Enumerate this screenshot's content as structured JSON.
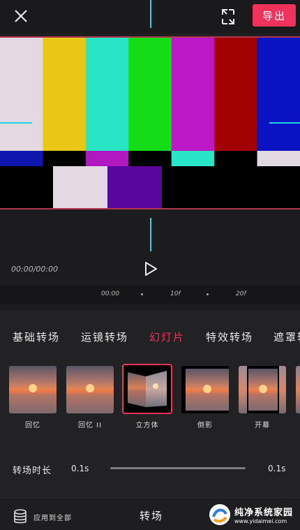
{
  "topbar": {
    "export_label": "导出"
  },
  "preview": {
    "bars_top": [
      "#e2d9e2",
      "#e9c714",
      "#28e5c6",
      "#14dc16",
      "#bd18c6",
      "#a20102",
      "#0a13c4"
    ],
    "bars_mid": [
      "#0f16b0",
      "#000000",
      "#b218c0",
      "#000000",
      "#28e5c6",
      "#000000",
      "#e2d9e2"
    ],
    "bars_bottom": [
      "#000000",
      "#e2d9e2",
      "#58069c",
      "#000000",
      "#000000",
      "#000000",
      "#000000"
    ]
  },
  "timeline": {
    "time": "00:00/00:00",
    "ticks": [
      "00:00",
      "10f",
      "20f"
    ]
  },
  "tabs": [
    {
      "label": "基础转场"
    },
    {
      "label": "运镜转场"
    },
    {
      "label": "幻灯片"
    },
    {
      "label": "特效转场"
    },
    {
      "label": "遮罩转"
    }
  ],
  "transitions": [
    {
      "label": "回忆"
    },
    {
      "label": "回忆 II"
    },
    {
      "label": "立方体"
    },
    {
      "label": "倒影"
    },
    {
      "label": "开幕"
    }
  ],
  "duration": {
    "label": "转场时长",
    "value_left": "0.1s",
    "value_right": "0.1s"
  },
  "bottombar": {
    "apply_all": "应用到全部",
    "title": "转场"
  },
  "watermark": {
    "name": "纯净系统家园",
    "url": "www.yidaimei.com"
  },
  "colors": {
    "accent": "#f0315c",
    "cursor": "#1ed4e6"
  }
}
